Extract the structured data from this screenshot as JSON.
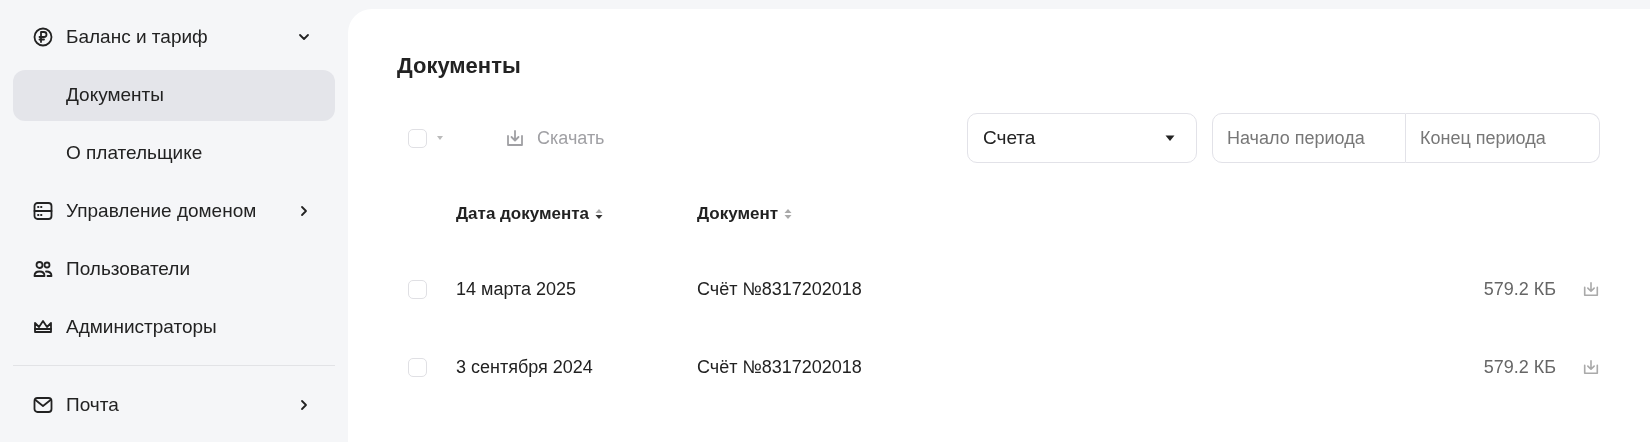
{
  "sidebar": {
    "sections": [
      [
        {
          "label": "Баланс и тариф",
          "selected": false,
          "expanded": true,
          "children": [
            {
              "label": "Документы",
              "selected": true
            },
            {
              "label": "О плательщике",
              "selected": false
            }
          ]
        },
        {
          "label": "Управление доменом",
          "selected": false,
          "expanded": false
        },
        {
          "label": "Пользователи",
          "selected": false
        },
        {
          "label": "Администраторы",
          "selected": false
        }
      ],
      [
        {
          "label": "Почта",
          "selected": false,
          "expanded": false
        }
      ]
    ]
  },
  "main": {
    "title": "Документы",
    "toolbar": {
      "select_all": {
        "checked": false
      },
      "download": {
        "label": "Скачать",
        "disabled": true
      },
      "type_select": {
        "value": "Счета"
      },
      "period": {
        "start": {
          "placeholder": "Начало периода"
        },
        "end": {
          "placeholder": "Конец периода"
        }
      }
    },
    "table": {
      "columns": [
        {
          "label": "Дата документа",
          "sorted": true
        },
        {
          "label": "Документ",
          "sorted": false
        }
      ],
      "rows": [
        {
          "checked": false,
          "date": "14 марта 2025",
          "document": "Счёт №8317202018",
          "size": "579.2 КБ"
        },
        {
          "checked": false,
          "date": "3 сентября 2024",
          "document": "Счёт №8317202018",
          "size": "579.2 КБ"
        }
      ]
    }
  }
}
